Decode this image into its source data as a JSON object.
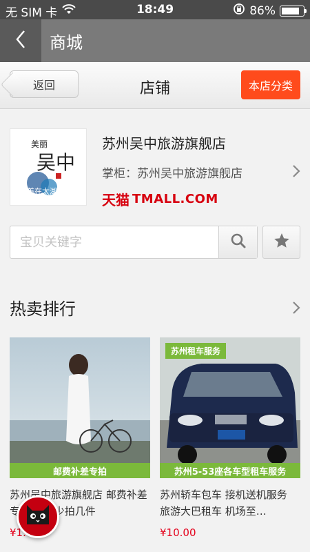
{
  "status_bar": {
    "carrier": "无 SIM 卡",
    "time": "18:49",
    "battery_percent": "86%",
    "battery_level": 0.86
  },
  "app_header": {
    "title": "商城"
  },
  "store_header": {
    "back_label": "返回",
    "title": "店铺",
    "category_label": "本店分类",
    "accent_color": "#ff4b1c"
  },
  "shop": {
    "name": "苏州吴中旅游旗舰店",
    "owner": "掌柜：苏州吴中旅游旗舰店",
    "tmall_cn": "天猫",
    "tmall_en": "TMALL.COM",
    "logo_text": [
      "美丽",
      "吴中",
      "美在太湖"
    ]
  },
  "search": {
    "placeholder": "宝贝关键字",
    "value": ""
  },
  "hot": {
    "title": "热卖排行",
    "items": [
      {
        "image_banner": "邮费补差专拍",
        "name": "苏州吴中旅游旗舰店 邮费补差专拍 差多少拍几件",
        "price": "¥1.00"
      },
      {
        "image_tag": "苏州租车服务",
        "image_banner": "苏州5-53座各车型租车服务",
        "name": "苏州轿车包车 接机送机服务 旅游大巴租车 机场至…",
        "price": "¥10.00"
      }
    ]
  },
  "colors": {
    "price": "#e4001b",
    "tmall": "#d7000f",
    "banner_green": "#7bb93b"
  }
}
